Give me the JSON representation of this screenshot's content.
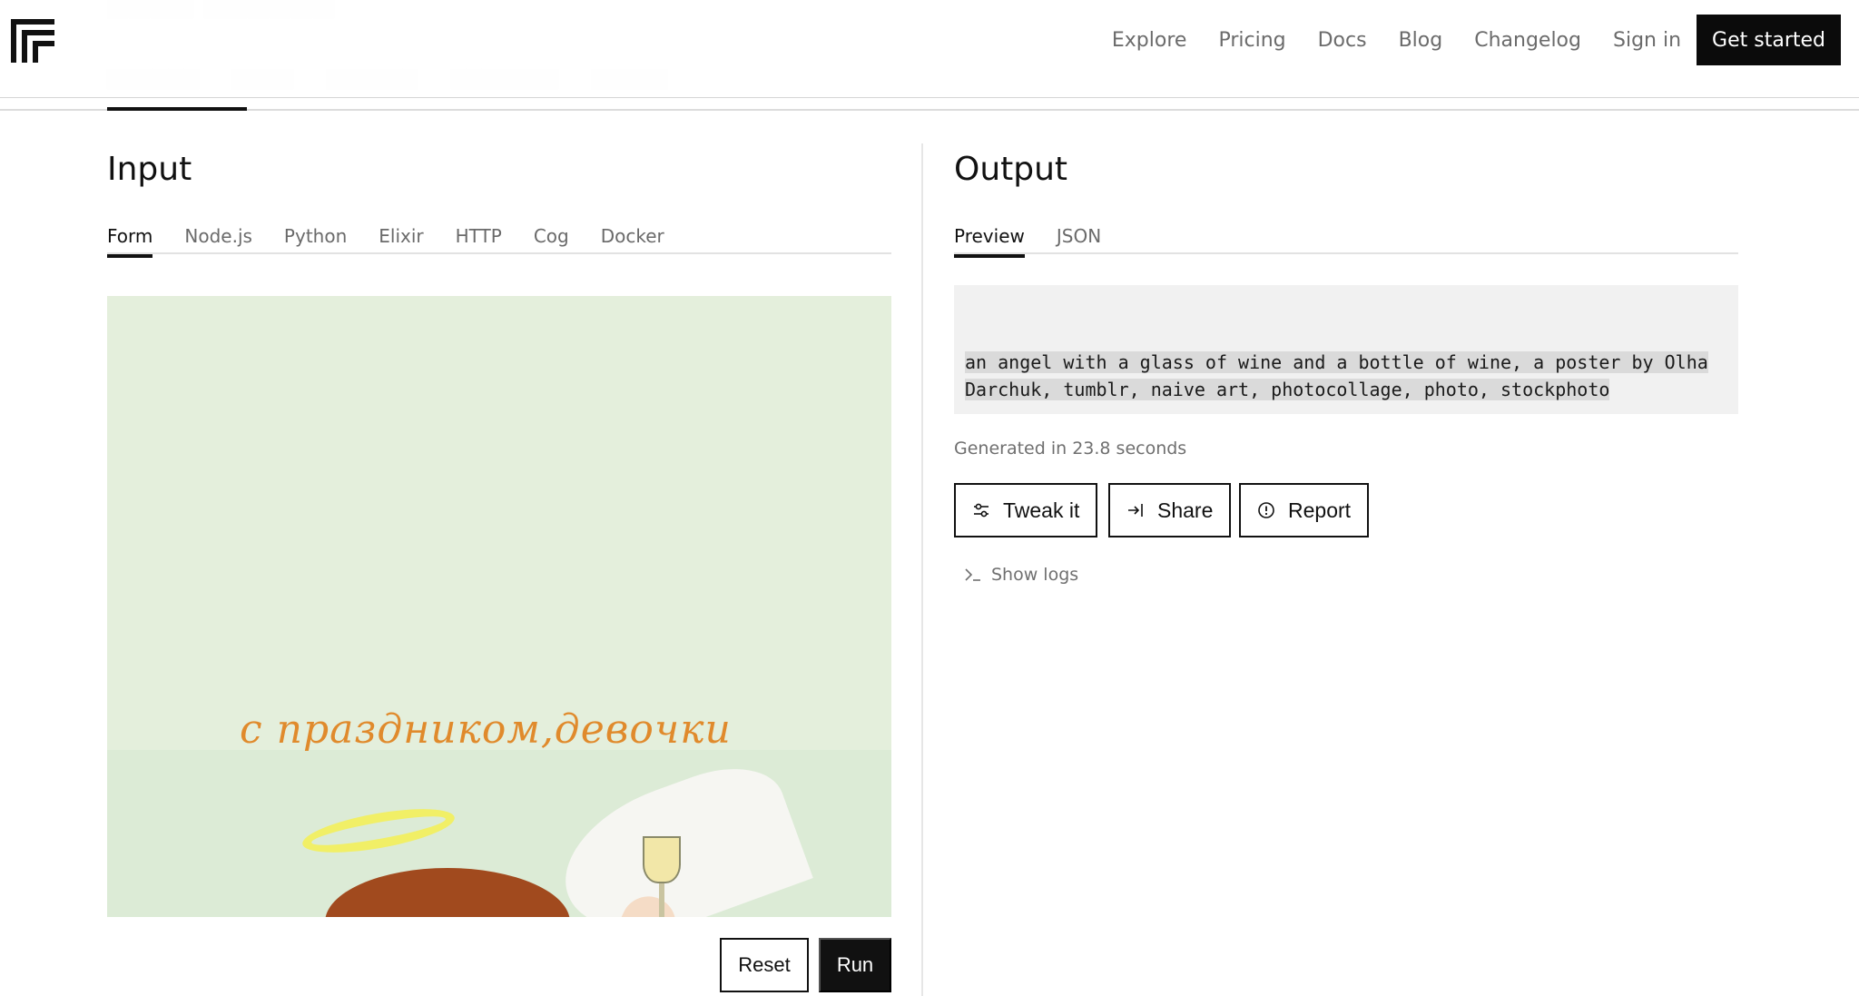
{
  "navbar": {
    "links": [
      "Explore",
      "Pricing",
      "Docs",
      "Blog",
      "Changelog",
      "Sign in"
    ],
    "cta": "Get started"
  },
  "input": {
    "title": "Input",
    "tabs": [
      "Form",
      "Node.js",
      "Python",
      "Elixir",
      "HTTP",
      "Cog",
      "Docker"
    ],
    "active_tab": "Form",
    "image_caption": "с праздником,девочки",
    "reset_label": "Reset",
    "run_label": "Run"
  },
  "output": {
    "title": "Output",
    "tabs": [
      "Preview",
      "JSON"
    ],
    "active_tab": "Preview",
    "text_line1": "an angel with a glass of wine and a bottle of wine, a poster by Olha",
    "text_line2": "Darchuk, tumblr, naive art, photocollage, photo, stockphoto",
    "generated": "Generated in 23.8 seconds",
    "actions": [
      {
        "label": "Tweak it",
        "icon": "sliders-icon"
      },
      {
        "label": "Share",
        "icon": "share-icon"
      },
      {
        "label": "Report",
        "icon": "alert-circle-icon"
      }
    ],
    "logs_label": "Show logs"
  },
  "colors": {
    "accent": "#111111",
    "muted": "#6b6b6b",
    "output_bg": "#f1f1f1",
    "image_bg": "#e4efdc",
    "caption": "#e08a2c"
  }
}
